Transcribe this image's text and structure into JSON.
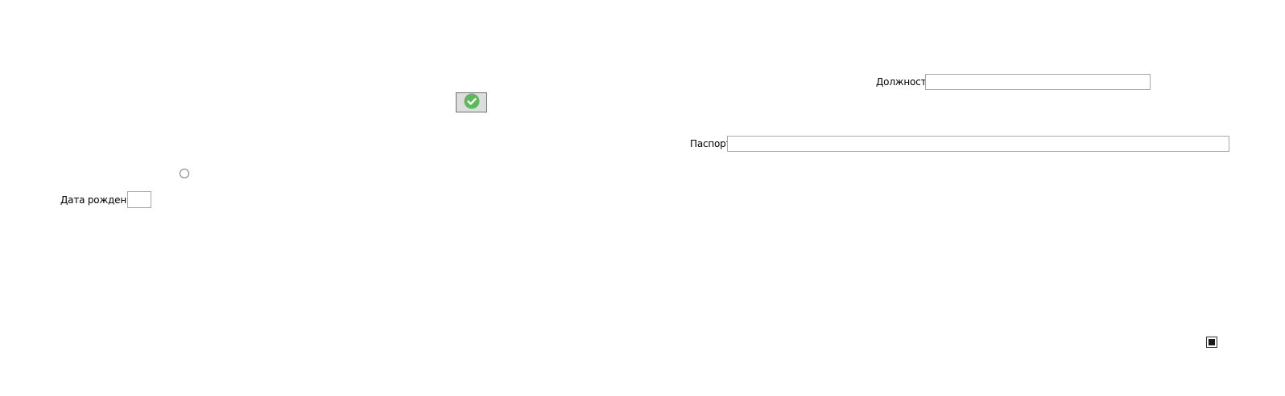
{
  "form": {
    "position": {
      "label": "Должность",
      "value": "",
      "placeholder": ""
    },
    "passport": {
      "label": "Паспорт",
      "value": "",
      "placeholder": ""
    },
    "birth_date": {
      "label": "Дата рождения",
      "value": "",
      "placeholder": ""
    },
    "confirm_button": {
      "icon": "checkmark-icon",
      "icon_color": "#5bb85b"
    },
    "radio": {
      "checked": false
    },
    "checkbox": {
      "state": "indeterminate"
    }
  }
}
